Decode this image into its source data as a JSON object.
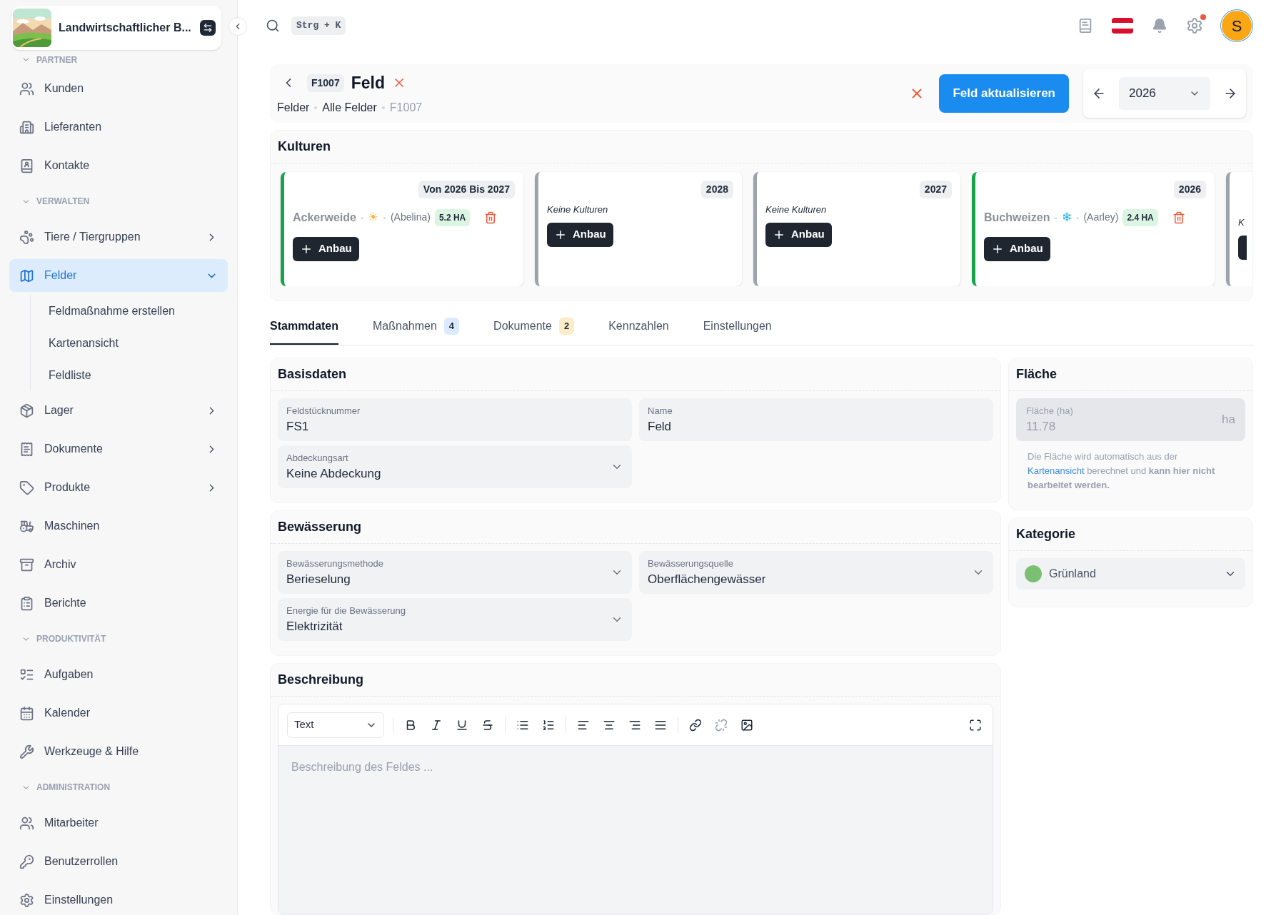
{
  "sidebar": {
    "company": "Landwirtschaftlicher B...",
    "sections": [
      {
        "title": "PARTNER",
        "expanded": true,
        "items": [
          {
            "label": "Kunden",
            "selected": false
          },
          {
            "label": "Lieferanten",
            "selected": false
          },
          {
            "label": "Kontakte",
            "selected": false
          }
        ]
      },
      {
        "title": "VERWALTEN",
        "expanded": true,
        "items": [
          {
            "label": "Tiere / Tiergruppen",
            "selected": false,
            "expanded": false
          },
          {
            "label": "Felder",
            "selected": true,
            "expanded": true,
            "children": [
              {
                "label": "Feldmaßnahme erstellen",
                "selected": false
              },
              {
                "label": "Kartenansicht",
                "selected": false
              },
              {
                "label": "Feldliste",
                "selected": false
              }
            ]
          },
          {
            "label": "Lager",
            "selected": false,
            "expanded": false
          },
          {
            "label": "Dokumente",
            "selected": false,
            "expanded": false
          },
          {
            "label": "Produkte",
            "selected": false,
            "expanded": false
          },
          {
            "label": "Maschinen",
            "selected": false
          },
          {
            "label": "Archiv",
            "selected": false
          },
          {
            "label": "Berichte",
            "selected": false
          }
        ]
      },
      {
        "title": "PRODUKTIVITÄT",
        "expanded": true,
        "items": [
          {
            "label": "Aufgaben",
            "selected": false
          },
          {
            "label": "Kalender",
            "selected": false
          },
          {
            "label": "Werkzeuge & Hilfe",
            "selected": false
          }
        ]
      },
      {
        "title": "ADMINISTRATION",
        "expanded": true,
        "items": [
          {
            "label": "Mitarbeiter",
            "selected": false
          },
          {
            "label": "Benutzerrollen",
            "selected": false
          },
          {
            "label": "Einstellungen",
            "selected": false
          }
        ]
      }
    ]
  },
  "topbar": {
    "shortcut": "Strg + K",
    "avatar": "S",
    "settings_dot": true
  },
  "header": {
    "code": "F1007",
    "title": "Feld",
    "breadcrumb": [
      {
        "label": "Felder",
        "current": false
      },
      {
        "label": "Alle Felder",
        "current": false
      },
      {
        "label": "F1007",
        "current": true
      }
    ],
    "primary_button": "Feld aktualisieren",
    "year": "2026"
  },
  "kulturen": {
    "title": "Kulturen",
    "cards": [
      {
        "kind": "crop",
        "color": "#16a34a",
        "period": "Von 2026 Bis 2027",
        "crop": "Ackerweide",
        "separator": "-",
        "symbol": {
          "text": "☀",
          "color": "#f5b342"
        },
        "variety": "(Abelina)",
        "area": "5.2 HA",
        "button": "Anbau"
      },
      {
        "kind": "empty",
        "color": "#9ca3af",
        "period": "2028",
        "note": "Keine Kulturen",
        "button": "Anbau"
      },
      {
        "kind": "empty",
        "color": "#9ca3af",
        "period": "2027",
        "note": "Keine Kulturen",
        "button": "Anbau"
      },
      {
        "kind": "crop",
        "color": "#16a34a",
        "period": "2026",
        "crop": "Buchweizen",
        "separator": "-",
        "symbol": {
          "text": "❄",
          "color": "#25b4e8"
        },
        "variety": "(Aarley)",
        "area": "2.4 HA",
        "button": "Anbau"
      },
      {
        "kind": "cut",
        "color": "#9ca3af",
        "note": "K"
      }
    ]
  },
  "tabs": [
    {
      "label": "Stammdaten",
      "selected": true
    },
    {
      "label": "Maßnahmen",
      "selected": false,
      "badge": "4",
      "color": "#dbeafe"
    },
    {
      "label": "Dokumente",
      "selected": false,
      "badge": "2",
      "color": "#fdecc8"
    },
    {
      "label": "Kennzahlen",
      "selected": false
    },
    {
      "label": "Einstellungen",
      "selected": false
    }
  ],
  "basisdaten": {
    "title": "Basisdaten",
    "fields": [
      {
        "kind": "text",
        "label": "Feldstücknummer",
        "value": "FS1"
      },
      {
        "kind": "text",
        "label": "Name",
        "value": "Feld"
      },
      {
        "kind": "select",
        "label": "Abdeckungsart",
        "value": "Keine Abdeckung"
      }
    ]
  },
  "bewaesserung": {
    "title": "Bewässerung",
    "fields": [
      {
        "kind": "select",
        "label": "Bewässerungsmethode",
        "value": "Berieselung"
      },
      {
        "kind": "select",
        "label": "Bewässerungsquelle",
        "value": "Oberflächengewässer"
      },
      {
        "kind": "select",
        "label": "Energie für die Bewässerung",
        "value": "Elektrizität"
      }
    ]
  },
  "flaeche": {
    "title": "Fläche",
    "field": {
      "label": "Fläche (ha)",
      "value": "11.78",
      "unit": "ha",
      "disabled": true
    },
    "note_start": "Die Fläche wird automatisch aus der",
    "link": "Kartenansicht",
    "note_end": "berechnet und **kann hier nicht bearbeitet werden.**"
  },
  "kategorie": {
    "title": "Kategorie",
    "value": "Grünland",
    "color": "#7bbf72"
  },
  "beschreibung": {
    "title": "Beschreibung",
    "format": "Text",
    "placeholder": "Beschreibung des Feldes ..."
  }
}
